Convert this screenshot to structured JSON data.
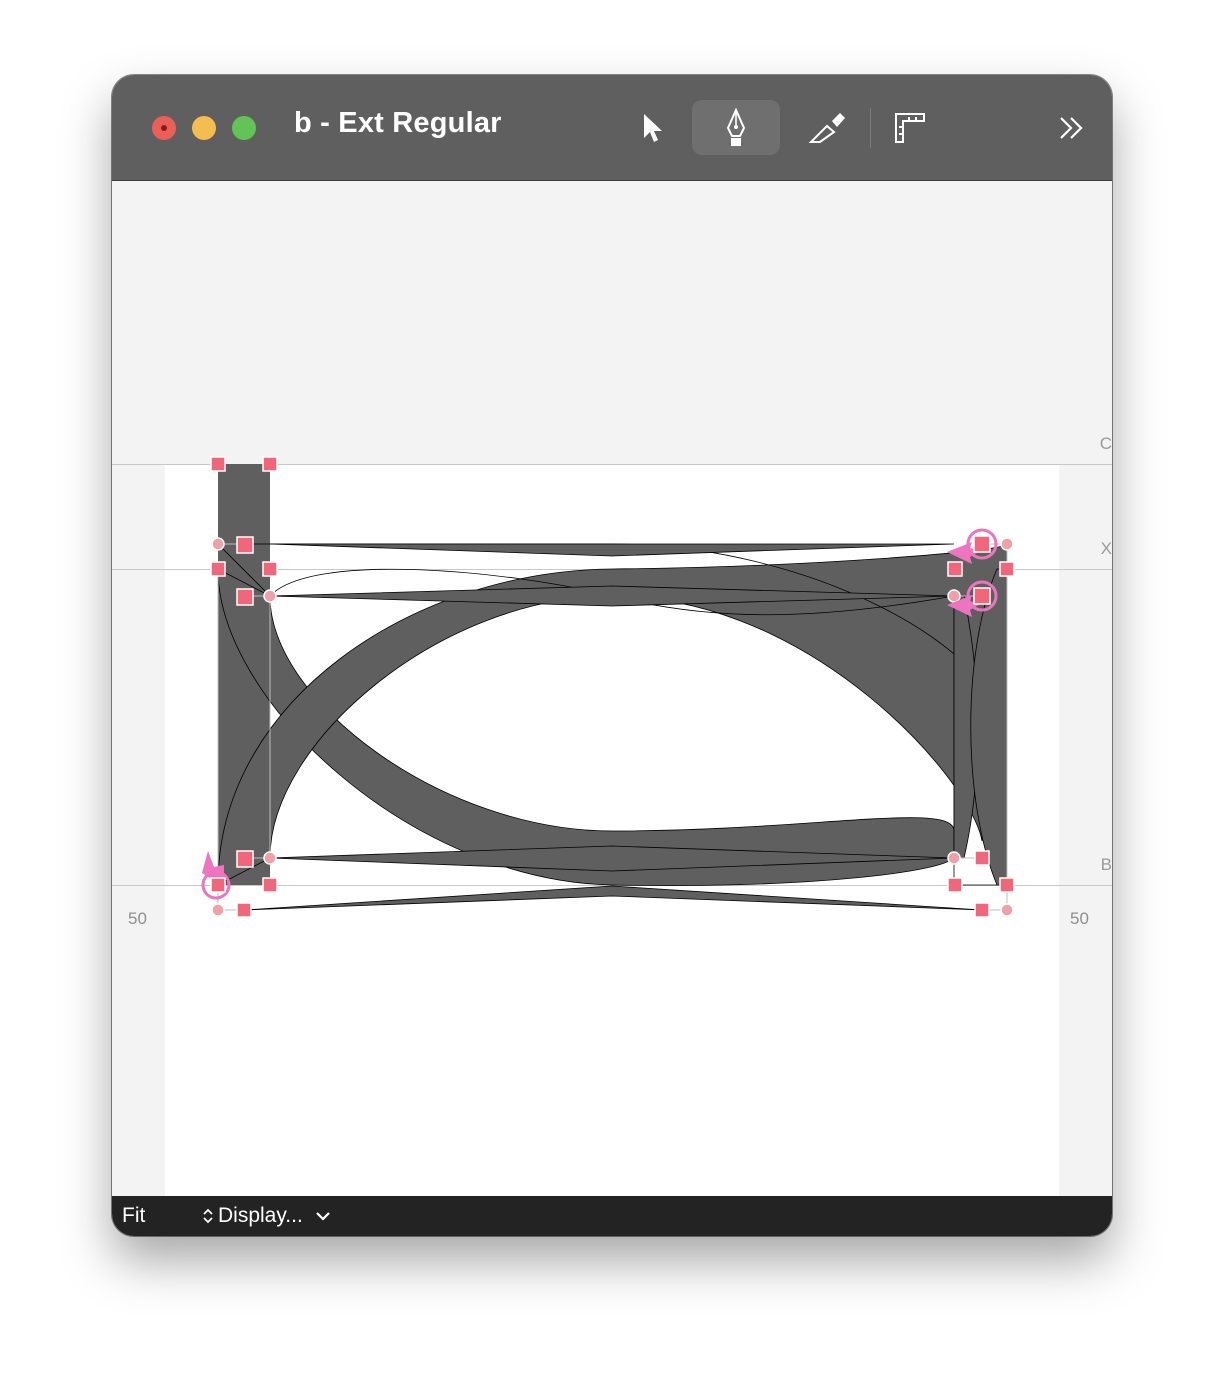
{
  "window": {
    "title": "b - Ext Regular"
  },
  "toolbar": {
    "tools": [
      {
        "icon": "arrow-pointer-icon",
        "label": "Select"
      },
      {
        "icon": "pen-nib-icon",
        "label": "Pen",
        "active": true
      },
      {
        "icon": "knife-icon",
        "label": "Knife"
      },
      {
        "icon": "ruler-icon",
        "label": "Measure"
      },
      {
        "icon": "chevron-double-right-icon",
        "label": "More"
      }
    ]
  },
  "canvas": {
    "metrics": {
      "cap_label": "C",
      "xheight_label": "X",
      "baseline_label": "B"
    },
    "left_sidebearing": "50",
    "right_sidebearing": "50"
  },
  "bottom_bar": {
    "zoom": "Fit",
    "display_menu": "Display..."
  },
  "colors": {
    "titlebar": "#5e5f5e",
    "glyph_fill": "#5f5f5f",
    "node": "#f0667a",
    "start_marker": "#ee74bf"
  }
}
